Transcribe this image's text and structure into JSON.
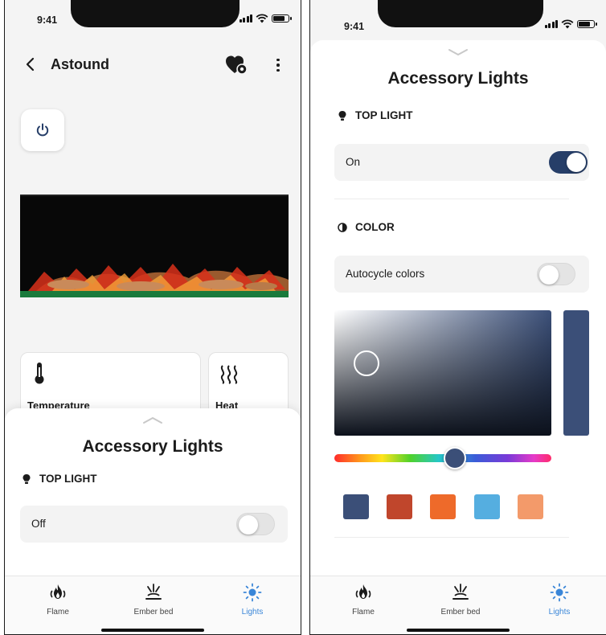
{
  "status_bar": {
    "time": "9:41"
  },
  "device_screen": {
    "header": {
      "title": "Astound"
    },
    "tiles": [
      {
        "label": "Temperature"
      },
      {
        "label": "Heat"
      }
    ],
    "sheet": {
      "title": "Accessory Lights",
      "top_light": {
        "header": "TOP LIGHT",
        "label": "Off",
        "enabled": false
      }
    }
  },
  "lights_screen": {
    "sheet": {
      "title": "Accessory Lights",
      "top_light": {
        "header": "TOP LIGHT",
        "label": "On",
        "enabled": true
      },
      "color": {
        "header": "COLOR",
        "autocycle": {
          "label": "Autocycle colors",
          "enabled": false
        },
        "selected_color": "#3b4f78",
        "swatches": [
          "#3b4f78",
          "#c0462c",
          "#ee6a2a",
          "#55aee0",
          "#f39a6a"
        ]
      }
    }
  },
  "tabs": [
    {
      "label": "Flame",
      "icon": "flame-icon",
      "active": false
    },
    {
      "label": "Ember bed",
      "icon": "ember-bed-icon",
      "active": false
    },
    {
      "label": "Lights",
      "icon": "sun-icon",
      "active": true
    }
  ],
  "colors": {
    "accent": "#263e68",
    "active_tab": "#3a86d8"
  }
}
